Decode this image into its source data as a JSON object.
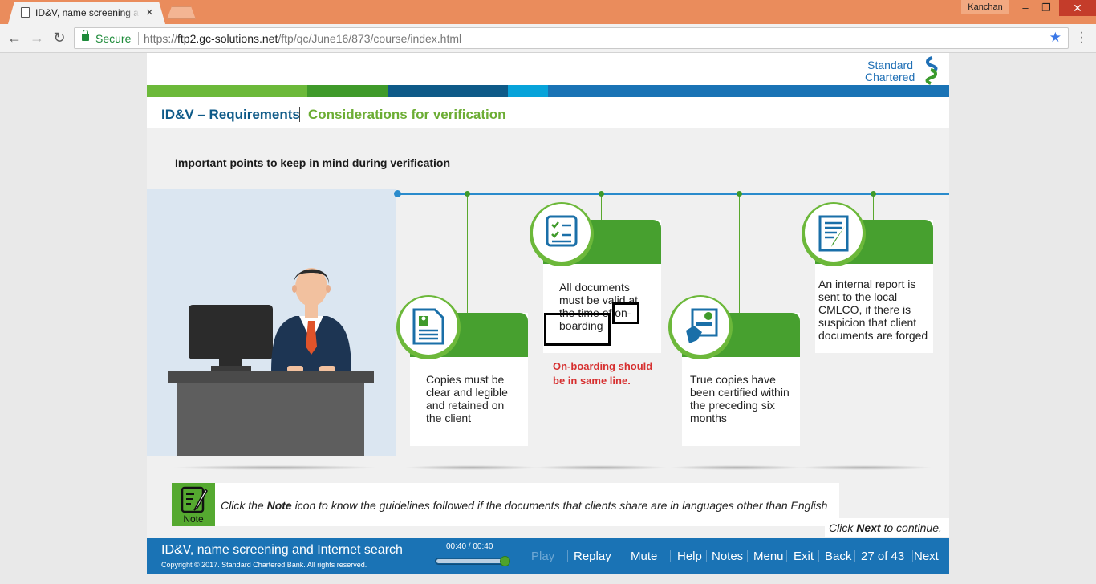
{
  "browser": {
    "tab_title": "ID&V, name screening an",
    "tab_close": "×",
    "user": "Kanchan",
    "win_min": "–",
    "win_max": "❐",
    "win_close": "✕",
    "back": "←",
    "forward": "→",
    "reload": "↻",
    "secure_label": "Secure",
    "url_scheme": "https://",
    "url_host": "ftp2.gc-solutions.net",
    "url_path": "/ftp/qc/June16/873/course/index.html",
    "bookmark_star": "★"
  },
  "brand": {
    "line1": "Standard",
    "line2": "Chartered"
  },
  "colors": {
    "strip": [
      "#6cb93a",
      "#3f9a2a",
      "#0e5a88",
      "#07a3da",
      "#1a73b5"
    ],
    "green": "#47a02f",
    "blue": "#1a73b5"
  },
  "breadcrumb": {
    "section": "ID&V – Requirements",
    "topic": "Considerations for verification"
  },
  "heading": "Important points to keep in mind during verification",
  "cards": [
    {
      "icon": "document-profile-icon",
      "text": [
        "Copies must be",
        "clear and legible",
        "and retained on",
        "the client"
      ]
    },
    {
      "icon": "checklist-icon",
      "text": [
        "All documents",
        "must be valid at",
        "the time of on-",
        "boarding"
      ]
    },
    {
      "icon": "certificate-icon",
      "text": [
        "True copies have",
        "been certified within",
        "the preceding six",
        "months"
      ]
    },
    {
      "icon": "report-icon",
      "text": [
        "An internal report is",
        "sent to the local",
        "CMLCO, if there is",
        "suspicion that client",
        "documents are forged"
      ]
    }
  ],
  "annotation": {
    "text": [
      "On-boarding should",
      "be in same line."
    ]
  },
  "note": {
    "label": "Note",
    "text_pre": "Click the ",
    "text_bold": "Note",
    "text_post": " icon to know the guidelines followed if the documents that clients share are in languages other than English"
  },
  "continue": {
    "pre": "Click ",
    "bold": "Next",
    "post": " to continue."
  },
  "footer": {
    "course_title": "ID&V, name screening and Internet search",
    "copyright": "Copyright © 2017. Standard Chartered Bank. All rights reserved.",
    "timer": "00:40 / 00:40",
    "progress": 1.0,
    "controls": {
      "play": "Play",
      "replay": "Replay",
      "mute": "Mute",
      "help": "Help",
      "notes": "Notes",
      "menu": "Menu",
      "exit": "Exit",
      "back": "Back",
      "page": "27 of 43",
      "next": "Next"
    }
  }
}
